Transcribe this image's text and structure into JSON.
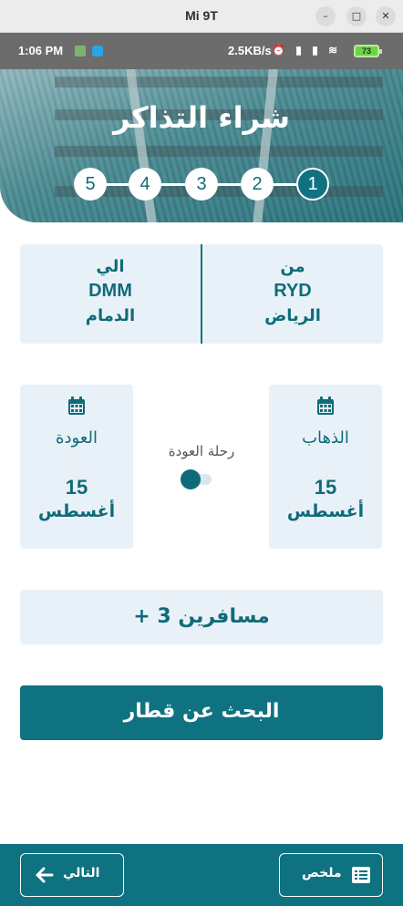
{
  "window": {
    "title": "Mi 9T",
    "minimize": "–",
    "maximize": "□",
    "close": "✕"
  },
  "status_bar": {
    "time": "1:06 PM",
    "speed": "2.5KB/s",
    "icons": "⏰ ▮ ▮ ≋",
    "battery": "73"
  },
  "header": {
    "title": "شراء التذاكر",
    "steps": [
      "5",
      "4",
      "3",
      "2",
      "1"
    ],
    "active_step": "1"
  },
  "route": {
    "from": {
      "label": "من",
      "code": "RYD",
      "city": "الرياض"
    },
    "to": {
      "label": "الي",
      "code": "DMM",
      "city": "الدمام"
    }
  },
  "dates": {
    "departure": {
      "label": "الذهاب",
      "day": "15",
      "month": "أغسطس"
    },
    "return": {
      "label": "العودة",
      "day": "15",
      "month": "أغسطس"
    }
  },
  "return_trip": {
    "label": "رحلة العودة",
    "enabled": true
  },
  "passengers": {
    "label": "+ 3 مسافرين"
  },
  "search_button": {
    "label": "البحث عن قطار"
  },
  "bottom_bar": {
    "summary_label": "ملخص",
    "next_label": "التالي"
  },
  "colors": {
    "primary": "#0f7281",
    "card_bg": "#e9f1f8"
  }
}
